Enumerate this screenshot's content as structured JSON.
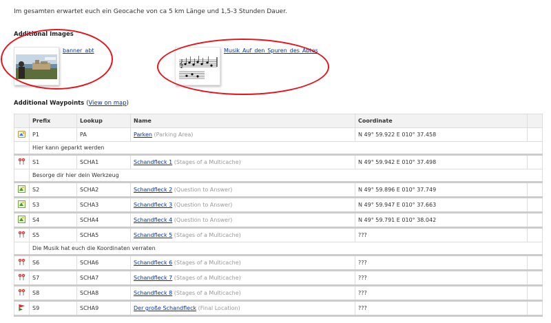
{
  "intro": "Im gesamten erwartet euch ein Geocache von ca 5 km Länge und 1,5-3 Stunden Dauer.",
  "additional_images": {
    "title": "Additional Images",
    "images": [
      {
        "label": "banner_abt"
      },
      {
        "label": "Musik_Auf_den_Spuren_des_Abtes"
      }
    ]
  },
  "waypoints": {
    "title": "Additional Waypoints",
    "view_map_link": "View on map",
    "open_paren": "(",
    "close_paren": ")",
    "headers": {
      "prefix": "Prefix",
      "lookup": "Lookup",
      "name": "Name",
      "coordinate": "Coordinate"
    },
    "rows": [
      {
        "icon": "parking-icon",
        "prefix": "P1",
        "lookup": "PA",
        "name": "Parken",
        "type": "(Parking Area)",
        "coordinate": "N 49° 59.922 E 010° 37.458",
        "note": "Hier kann geparkt werden"
      },
      {
        "icon": "multicache-stage-icon",
        "prefix": "S1",
        "lookup": "SCHA1",
        "name": "Schandfleck 1",
        "type": "(Stages of a Multicache)",
        "coordinate": "N 49° 59.942 E 010° 37.498",
        "note": "Besorge dir hier dein Werkzeug"
      },
      {
        "icon": "question-icon",
        "prefix": "S2",
        "lookup": "SCHA2",
        "name": "Schandfleck 2",
        "type": "(Question to Answer)",
        "coordinate": "N 49° 59.896 E 010° 37.749",
        "note": ""
      },
      {
        "icon": "question-icon",
        "prefix": "S3",
        "lookup": "SCHA3",
        "name": "Schandfleck 3",
        "type": "(Question to Answer)",
        "coordinate": "N 49° 59.947 E 010° 37.663",
        "note": ""
      },
      {
        "icon": "question-icon",
        "prefix": "S4",
        "lookup": "SCHA4",
        "name": "Schandfleck 4",
        "type": "(Question to Answer)",
        "coordinate": "N 49° 59.791 E 010° 38.042",
        "note": ""
      },
      {
        "icon": "multicache-stage-icon",
        "prefix": "S5",
        "lookup": "SCHA5",
        "name": "Schandfleck 5",
        "type": "(Stages of a Multicache)",
        "coordinate": "???",
        "note": "Die Musik hat euch die Koordinaten verraten"
      },
      {
        "icon": "multicache-stage-icon",
        "prefix": "S6",
        "lookup": "SCHA6",
        "name": "Schandfleck 6",
        "type": "(Stages of a Multicache)",
        "coordinate": "???",
        "note": ""
      },
      {
        "icon": "multicache-stage-icon",
        "prefix": "S7",
        "lookup": "SCHA7",
        "name": "Schandfleck 7",
        "type": "(Stages of a Multicache)",
        "coordinate": "???",
        "note": ""
      },
      {
        "icon": "multicache-stage-icon",
        "prefix": "S8",
        "lookup": "SCHA8",
        "name": "Schandfleck 8",
        "type": "(Stages of a Multicache)",
        "coordinate": "???",
        "note": ""
      },
      {
        "icon": "final-location-icon",
        "prefix": "S9",
        "lookup": "SCHA9",
        "name": "Der große Schandfleck",
        "type": "(Final Location)",
        "coordinate": "???",
        "note": ""
      }
    ]
  },
  "colors": {
    "link": "#0033aa",
    "annotation_oval": "#e8121b",
    "header_bg": "#f2f2f2"
  }
}
